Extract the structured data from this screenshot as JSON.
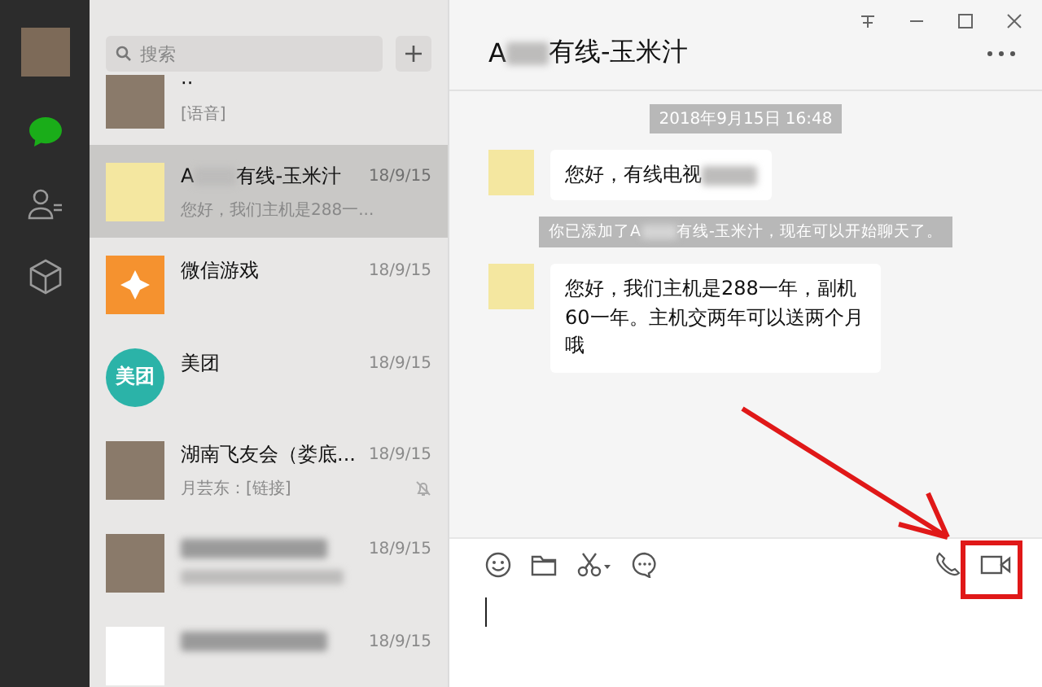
{
  "search": {
    "placeholder": "搜索"
  },
  "chats": [
    {
      "kind": "photo",
      "name": "··",
      "preview": "[语音]",
      "muted": false,
      "selected": false
    },
    {
      "kind": "cartoon",
      "name": "A",
      "name_after_blur": "有线-玉米汁",
      "time": "18/9/15",
      "preview": "您好，我们主机是288一...",
      "muted": false,
      "selected": true
    },
    {
      "kind": "game",
      "name": "微信游戏",
      "time": "18/9/15",
      "muted": false,
      "selected": false
    },
    {
      "kind": "meituan",
      "logo_text": "美团",
      "name": "美团",
      "time": "18/9/15",
      "muted": false,
      "selected": false
    },
    {
      "kind": "photo",
      "name": "湖南飞友会（娄底...",
      "time": "18/9/15",
      "preview": "月芸东：[链接]",
      "muted": true,
      "selected": false
    },
    {
      "kind": "photo",
      "time": "18/9/15",
      "muted": false,
      "selected": false
    },
    {
      "kind": "logo",
      "time": "18/9/15",
      "muted": false,
      "selected": false
    }
  ],
  "chat": {
    "title_start": "A",
    "title_end": "有线-玉米汁",
    "messages": [
      {
        "kind": "time",
        "text": "2018年9月15日 16:48"
      },
      {
        "kind": "incoming",
        "text": "您好，有线电视",
        "blurred_tail": true
      },
      {
        "kind": "system",
        "text": "你已添加了A",
        "text_after_blur": "有线-玉米汁，现在可以开始聊天了。"
      },
      {
        "kind": "incoming",
        "text": "您好，我们主机是288一年，副机60一年。主机交两年可以送两个月哦",
        "blurred_tail": false
      }
    ]
  },
  "annotation": {
    "kind": "arrow-to-video-call"
  }
}
